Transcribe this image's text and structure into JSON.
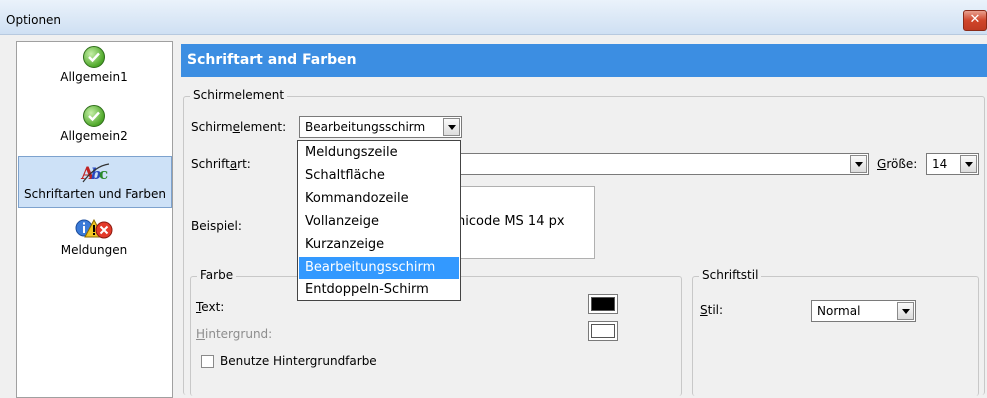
{
  "window": {
    "title": "Optionen",
    "close_glyph": "✕"
  },
  "sidebar": {
    "items": [
      {
        "label": "Allgemein1",
        "icon": "green-check-icon"
      },
      {
        "label": "Allgemein2",
        "icon": "green-check-icon"
      },
      {
        "label": "Schriftarten und Farben",
        "icon": "font-abc-icon",
        "selected": true
      },
      {
        "label": "Meldungen",
        "icon": "info-warning-error-icon"
      }
    ]
  },
  "panel": {
    "banner": "Schriftart and Farben",
    "screen_element_group": {
      "legend": "Schirmelement",
      "element_label_pre": "Schirm",
      "element_label_accel": "e",
      "element_label_post": "lement:",
      "element_value": "Bearbeitungsschirm",
      "font_label_pre": "Schrift",
      "font_label_accel": "a",
      "font_label_post": "rt:",
      "size_label_accel": "G",
      "size_label_post": "röße:",
      "size_value": "14",
      "sample_label": "Beispiel:",
      "sample_text": "nicode MS 14 px"
    },
    "color_group": {
      "legend": "Farbe",
      "text_label_accel": "T",
      "text_label_post": "ext:",
      "text_color": "#000000",
      "background_label_accel": "H",
      "background_label_post": "intergrund:",
      "background_color": "#ffffff",
      "use_background_label": "Benutze Hintergrundfarbe",
      "use_background_checked": false
    },
    "style_group": {
      "legend": "Schriftstil",
      "style_label_accel": "S",
      "style_label_post": "til:",
      "style_value": "Normal"
    }
  },
  "dropdown": {
    "options": [
      "Meldungszeile",
      "Schaltfläche",
      "Kommandozeile",
      "Vollanzeige",
      "Kurzanzeige",
      "Bearbeitungsschirm",
      "Entdoppeln-Schirm"
    ],
    "selected_index": 5
  },
  "colors": {
    "banner": "#3c8ee2",
    "selection": "#3399ff",
    "sidebar_selected": "#cde1f7"
  }
}
